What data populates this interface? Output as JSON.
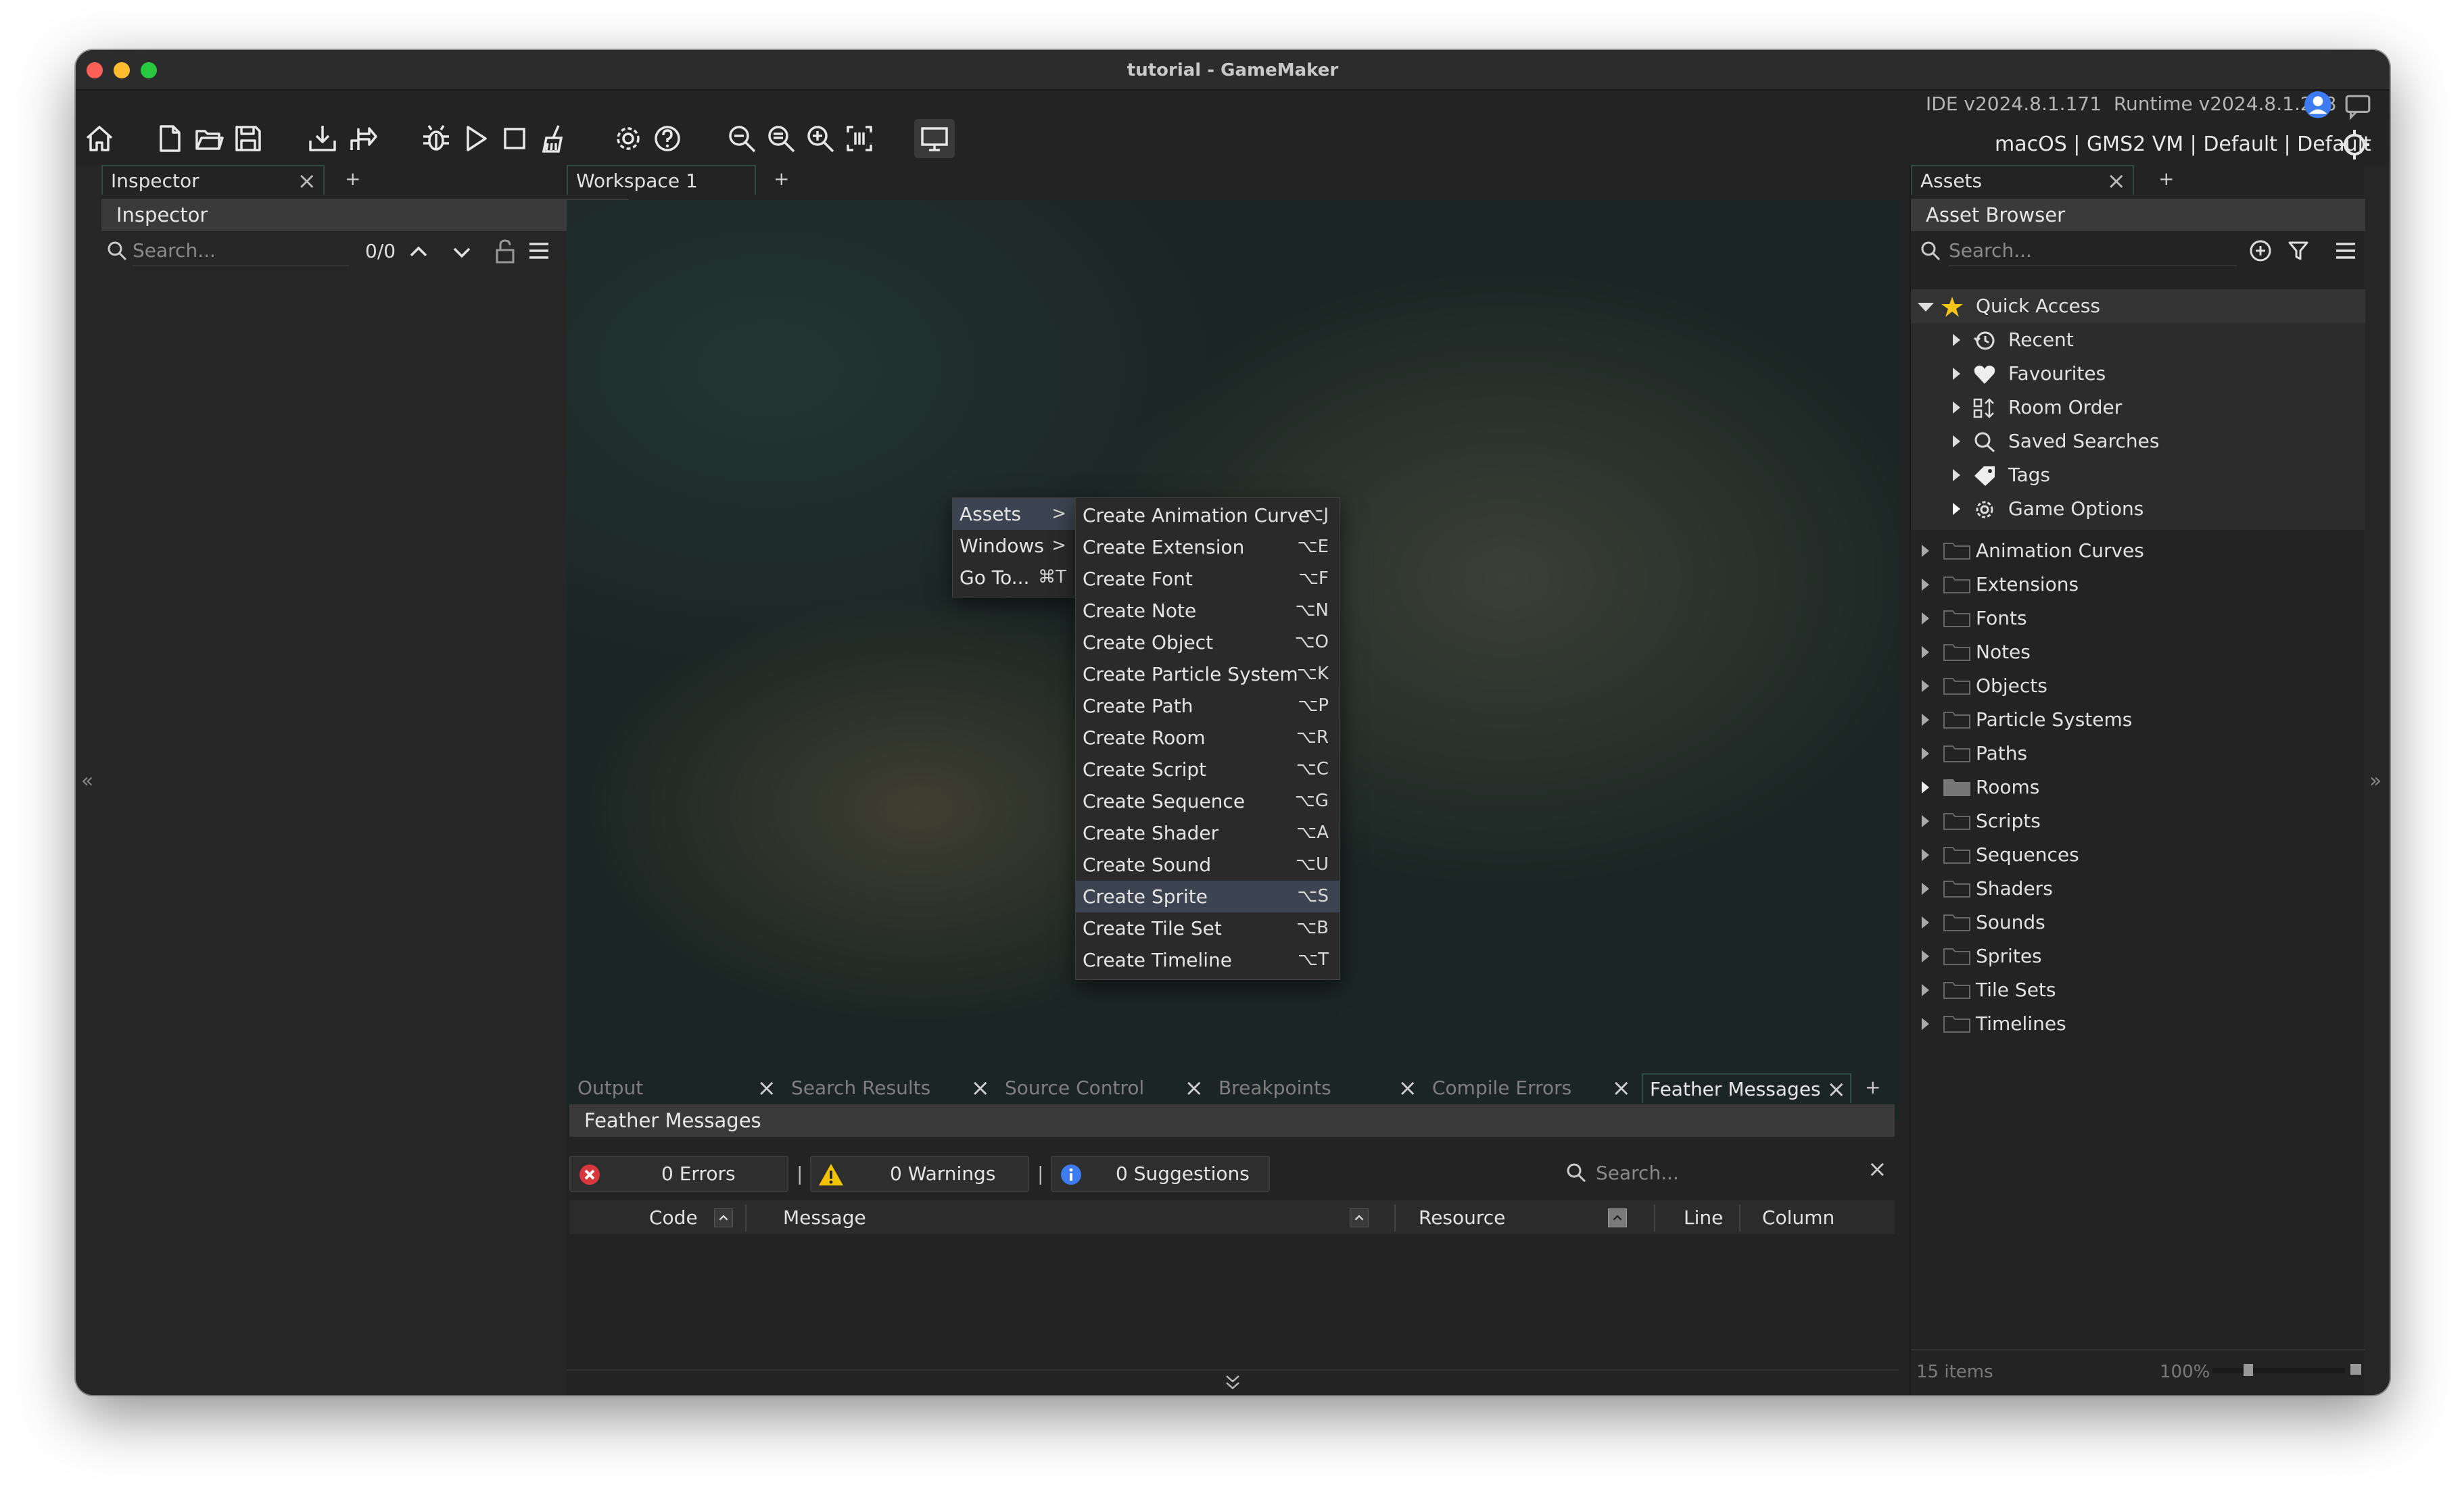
{
  "window": {
    "title": "tutorial - GameMaker",
    "ide_version": "IDE v2024.8.1.171",
    "runtime_version": "Runtime v2024.8.1.218",
    "target": "macOS | GMS2 VM | Default | Default"
  },
  "toolbar": {
    "icons": [
      "home-icon",
      "new-project-icon",
      "open-project-icon",
      "save-icon",
      "create-executable-icon",
      "export-icon",
      "debug-icon",
      "run-icon",
      "stop-icon",
      "clean-icon",
      "preferences-icon",
      "help-icon",
      "zoom-out-icon",
      "zoom-reset-icon",
      "zoom-in-icon",
      "fit-icon",
      "game-monitor-icon"
    ]
  },
  "inspector": {
    "tab": "Inspector",
    "header": "Inspector",
    "search_placeholder": "Search...",
    "count": "0/0"
  },
  "workspace": {
    "tab": "Workspace 1"
  },
  "context_menu": {
    "items": [
      {
        "label": "Assets",
        "arrow": ">"
      },
      {
        "label": "Windows",
        "arrow": ">"
      },
      {
        "label": "Go To...",
        "shortcut": "⌘T"
      }
    ],
    "submenu": [
      {
        "label": "Create Animation Curve",
        "shortcut": "⌥J"
      },
      {
        "label": "Create Extension",
        "shortcut": "⌥E"
      },
      {
        "label": "Create Font",
        "shortcut": "⌥F"
      },
      {
        "label": "Create Note",
        "shortcut": "⌥N"
      },
      {
        "label": "Create Object",
        "shortcut": "⌥O"
      },
      {
        "label": "Create Particle System",
        "shortcut": "⌥K"
      },
      {
        "label": "Create Path",
        "shortcut": "⌥P"
      },
      {
        "label": "Create Room",
        "shortcut": "⌥R"
      },
      {
        "label": "Create Script",
        "shortcut": "⌥C"
      },
      {
        "label": "Create Sequence",
        "shortcut": "⌥G"
      },
      {
        "label": "Create Shader",
        "shortcut": "⌥A"
      },
      {
        "label": "Create Sound",
        "shortcut": "⌥U"
      },
      {
        "label": "Create Sprite",
        "shortcut": "⌥S"
      },
      {
        "label": "Create Tile Set",
        "shortcut": "⌥B"
      },
      {
        "label": "Create Timeline",
        "shortcut": "⌥T"
      }
    ],
    "highlighted": "Create Sprite"
  },
  "assets": {
    "tab": "Assets",
    "header": "Asset Browser",
    "search_placeholder": "Search...",
    "quick_access": {
      "label": "Quick Access",
      "children": [
        "Recent",
        "Favourites",
        "Room Order",
        "Saved Searches",
        "Tags",
        "Game Options"
      ]
    },
    "folders": [
      "Animation Curves",
      "Extensions",
      "Fonts",
      "Notes",
      "Objects",
      "Particle Systems",
      "Paths",
      "Rooms",
      "Scripts",
      "Sequences",
      "Shaders",
      "Sounds",
      "Sprites",
      "Tile Sets",
      "Timelines"
    ],
    "item_count": "15 items",
    "zoom": "100%"
  },
  "bottom": {
    "tabs": [
      "Output",
      "Search Results",
      "Source Control",
      "Breakpoints",
      "Compile Errors",
      "Feather Messages"
    ],
    "active_tab": "Feather Messages",
    "header": "Feather Messages",
    "errors": "0 Errors",
    "warnings": "0 Warnings",
    "suggestions": "0 Suggestions",
    "search_placeholder": "Search...",
    "columns": [
      "Code",
      "Message",
      "Resource",
      "Line",
      "Column"
    ]
  },
  "colors": {
    "accent_tab_border": "#2f4a42",
    "error": "#d9363e",
    "warning": "#f2c300",
    "info": "#3d7cf0",
    "highlight": "#3b4450"
  }
}
